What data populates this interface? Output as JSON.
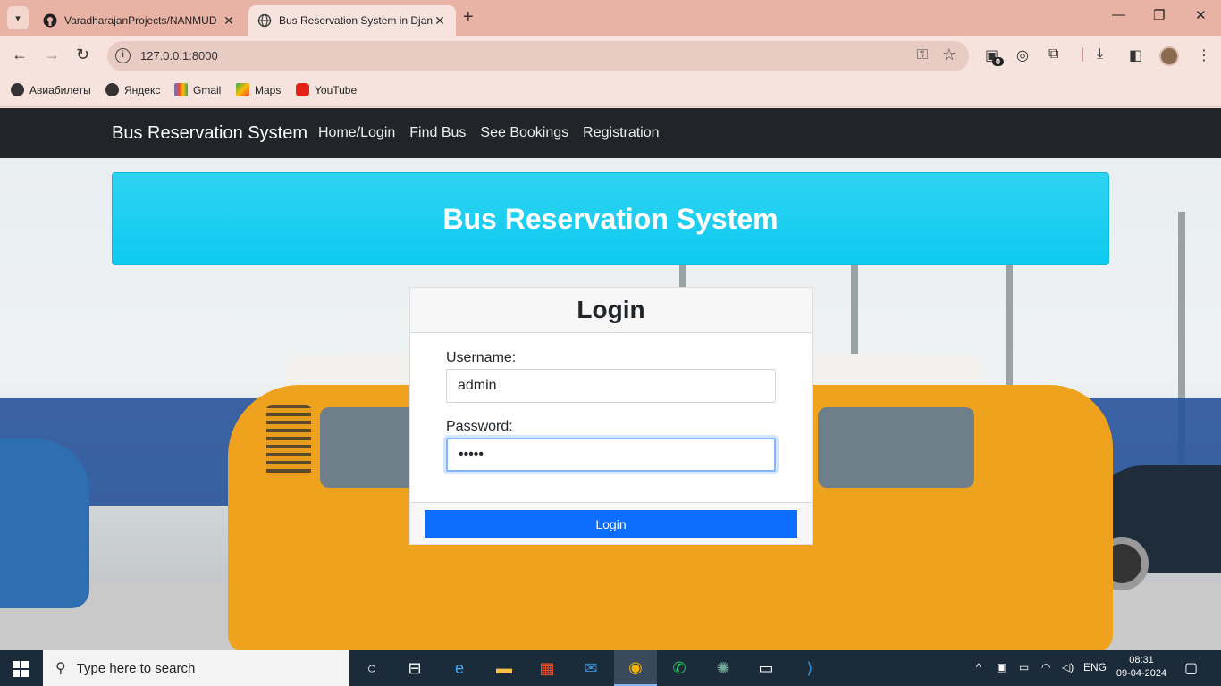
{
  "browser": {
    "tabs": [
      {
        "title": "VaradharajanProjects/NANMUD",
        "active": false
      },
      {
        "title": "Bus Reservation System in Djan",
        "active": true
      }
    ],
    "url": "127.0.0.1:8000",
    "extension_badge": "0",
    "bookmarks": [
      {
        "label": "Авиабилеты",
        "icon": "globe-icon"
      },
      {
        "label": "Яндекс",
        "icon": "globe-icon"
      },
      {
        "label": "Gmail",
        "icon": "gmail-icon"
      },
      {
        "label": "Maps",
        "icon": "maps-icon"
      },
      {
        "label": "YouTube",
        "icon": "youtube-icon"
      }
    ]
  },
  "site": {
    "brand": "Bus Reservation System",
    "nav": [
      "Home/Login",
      "Find Bus",
      "See Bookings",
      "Registration"
    ],
    "banner_title": "Bus Reservation System",
    "colors": {
      "navbar": "#212529",
      "banner": "#0dcaf0",
      "primary": "#0d6efd"
    }
  },
  "login": {
    "title": "Login",
    "username_label": "Username:",
    "username_value": "admin",
    "password_label": "Password:",
    "password_value": "•••••",
    "submit_label": "Login"
  },
  "taskbar": {
    "search_placeholder": "Type here to search",
    "language": "ENG",
    "time": "08:31",
    "date": "09-04-2024"
  }
}
